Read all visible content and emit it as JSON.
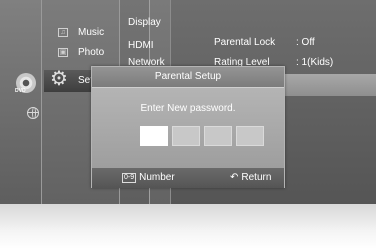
{
  "left_menu": {
    "dvd_label": "DVD",
    "items": [
      {
        "label": "Music",
        "icon": "music-icon"
      },
      {
        "label": "Photo",
        "icon": "photo-icon"
      },
      {
        "label": "Setup",
        "icon": "gear-icon"
      }
    ]
  },
  "submenu": {
    "items": [
      "Display",
      "HDMI",
      "Network"
    ]
  },
  "settings": {
    "rows": [
      {
        "label": "Parental Lock",
        "value": ": Off"
      },
      {
        "label": "Rating Level",
        "value": ": 1(Kids)"
      }
    ]
  },
  "dialog": {
    "title": "Parental Setup",
    "prompt": "Enter New password.",
    "password_boxes": 4,
    "active_box": 0,
    "footer": {
      "number_key": "0-9",
      "number_label": "Number",
      "return_label": "Return"
    }
  },
  "colors": {
    "highlight": "#3e3e3e",
    "dialog_body": "#b4b4b4",
    "active_box": "#ffffff"
  }
}
